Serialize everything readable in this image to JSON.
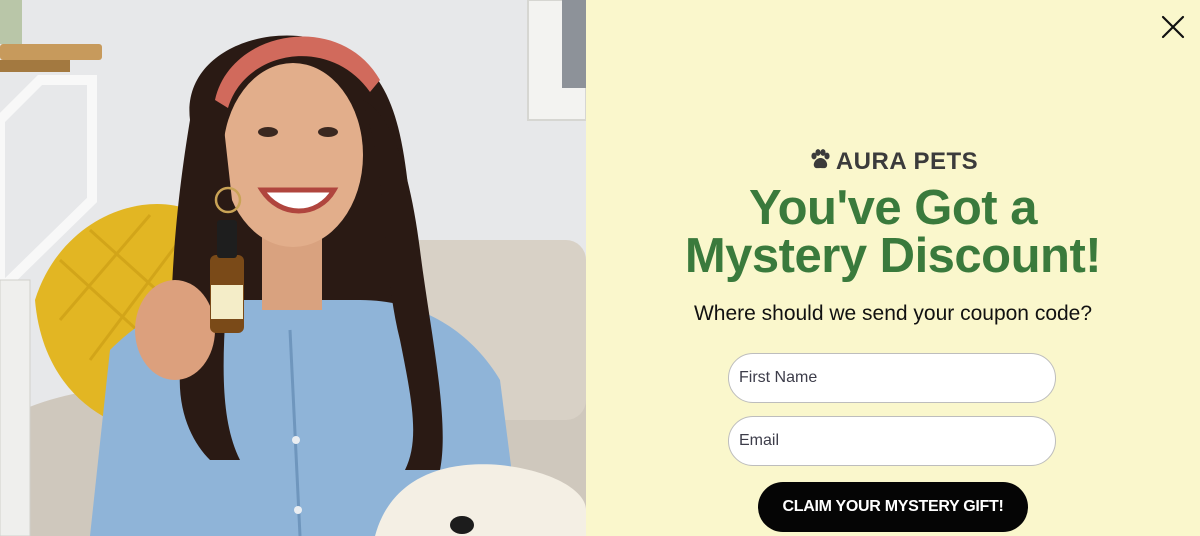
{
  "popup": {
    "brand_name": "AURA PETS",
    "headline_line1": "You've Got a",
    "headline_line2": "Mystery Discount!",
    "subheading": "Where should we send your coupon code?",
    "first_name_placeholder": "First Name",
    "email_placeholder": "Email",
    "cta_label": "CLAIM YOUR MYSTERY GIFT!"
  },
  "icons": {
    "close": "close-icon",
    "brand": "paw-icon"
  },
  "colors": {
    "panel_background": "#faf7cc",
    "headline": "#3a7a3c",
    "cta_background": "#050505",
    "cta_text": "#ffffff"
  }
}
